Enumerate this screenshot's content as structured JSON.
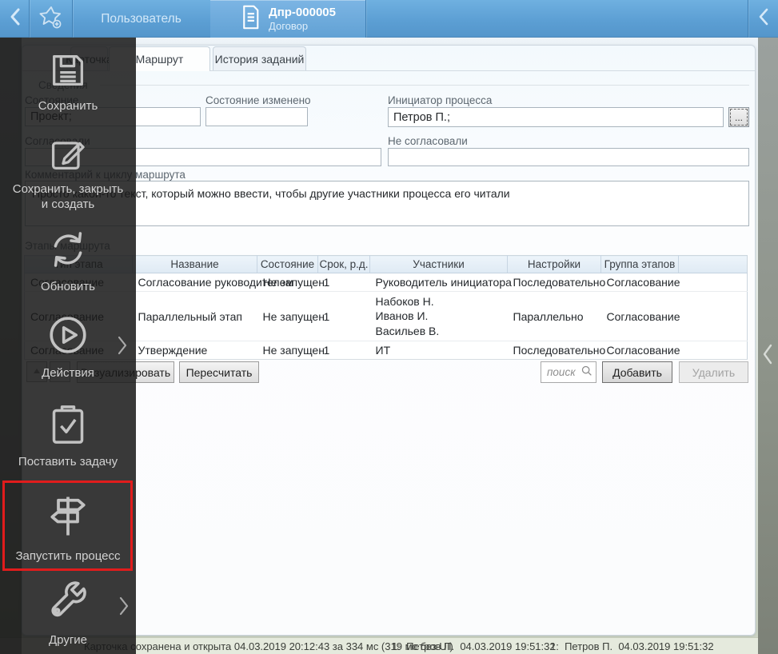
{
  "colors": {
    "accent_blue": "#5b9ed3",
    "highlight_red": "#e11c1c"
  },
  "topbar": {
    "user_tab": "Пользователь",
    "document_tab": {
      "title": "Дпр-000005",
      "subtitle": "Договор"
    }
  },
  "sidebar": {
    "items": [
      {
        "label": "Сохранить",
        "icon": "save"
      },
      {
        "label": "Сохранить, закрыть и создать",
        "icon": "edit"
      },
      {
        "label": "Обновить",
        "icon": "refresh"
      },
      {
        "label": "Действия",
        "icon": "play",
        "has_submenu": true
      },
      {
        "label": "Поставить задачу",
        "icon": "task"
      },
      {
        "label": "Запустить процесс",
        "icon": "signpost",
        "highlighted": true
      },
      {
        "label": "Другие",
        "icon": "wrench",
        "has_submenu": true
      }
    ]
  },
  "tabs": [
    {
      "label": "Карточка",
      "active": false
    },
    {
      "label": "Маршрут",
      "active": true
    },
    {
      "label": "История заданий",
      "active": false
    }
  ],
  "form": {
    "group_label": "Сведения",
    "state": {
      "label": "Состояние",
      "value": "Проект;"
    },
    "state_changed": {
      "label": "Состояние изменено",
      "value": ""
    },
    "initiator": {
      "label": "Инициатор процесса",
      "value": "Петров П.;",
      "picker_label": "..."
    },
    "approved": {
      "label": "Согласовали",
      "value": ""
    },
    "not_approved": {
      "label": "Не согласовали",
      "value": ""
    },
    "comment": {
      "label": "Комментарий к циклу маршрута",
      "value": "Просто какой-то текст, который можно ввести, чтобы другие участники процесса его читали"
    }
  },
  "stages": {
    "group_label": "Этапы маршрута"
  },
  "table": {
    "columns": [
      "Тип этапа",
      "Название",
      "Состояние",
      "Срок, р.д.",
      "Участники",
      "Настройки",
      "Группа этапов",
      ""
    ],
    "rows": [
      [
        "Согласование",
        "Согласование руководителем",
        "Не запущен",
        "1",
        "Руководитель инициатора",
        "Последовательно",
        "Согласование",
        ""
      ],
      [
        "Согласование",
        "Параллельный этап",
        "Не запущен",
        "1",
        "Набоков Н.\nИванов И.\nВасильев В.",
        "Параллельно",
        "Согласование",
        ""
      ],
      [
        "Согласование",
        "Утверждение",
        "Не запущен",
        "1",
        "ИТ",
        "Последовательно",
        "Согласование",
        ""
      ]
    ]
  },
  "actions": {
    "visualize": "Визуализировать",
    "recalculate": "Пересчитать",
    "search_placeholder": "поиск",
    "add": "Добавить",
    "delete": "Удалить"
  },
  "statusbar": {
    "message": "Карточка сохранена и открыта 04.03.2019 20:12:43 за 334 мс (319 мс без UI)",
    "entries": [
      "1:  Петров П.  04.03.2019 19:51:32",
      "1:  Петров П.  04.03.2019 19:51:32"
    ]
  }
}
